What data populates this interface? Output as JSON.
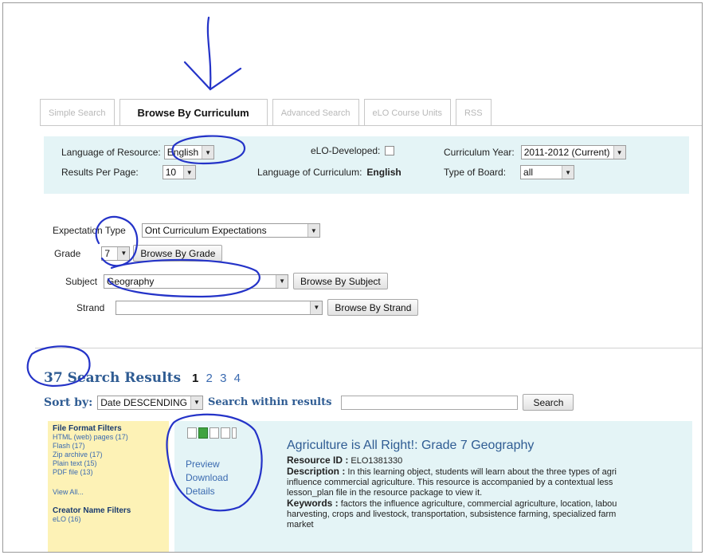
{
  "tabs": [
    {
      "label": "Simple Search",
      "active": false
    },
    {
      "label": "Browse By Curriculum",
      "active": true
    },
    {
      "label": "Advanced Search",
      "active": false
    },
    {
      "label": "eLO Course Units",
      "active": false
    },
    {
      "label": "RSS",
      "active": false
    }
  ],
  "options": {
    "language_resource_label": "Language of Resource:",
    "language_resource_value": "English",
    "elo_developed_label": "eLO-Developed:",
    "curriculum_year_label": "Curriculum Year:",
    "curriculum_year_value": "2011-2012 (Current)",
    "results_per_page_label": "Results Per Page:",
    "results_per_page_value": "10",
    "language_curriculum_label": "Language of Curriculum:",
    "language_curriculum_value": "English",
    "type_board_label": "Type of Board:",
    "type_board_value": "all"
  },
  "browse": {
    "expectation_type_label": "Expectation Type",
    "expectation_type_value": "Ont Curriculum Expectations",
    "grade_label": "Grade",
    "grade_value": "7",
    "browse_grade_button": "Browse By Grade",
    "subject_label": "Subject",
    "subject_value": "Geography",
    "browse_subject_button": "Browse By Subject",
    "strand_label": "Strand",
    "strand_value": "",
    "browse_strand_button": "Browse By Strand"
  },
  "results": {
    "count_text": "37 Search Results",
    "pages": [
      "1",
      "2",
      "3",
      "4"
    ],
    "current_page": "1",
    "sort_label": "Sort by:",
    "sort_value": "Date DESCENDING",
    "search_within_label": "Search within results",
    "search_button": "Search"
  },
  "filters": {
    "file_format_heading": "File Format Filters",
    "file_format_items": [
      "HTML (web) pages (17)",
      "Flash (17)",
      "Zip archive (17)",
      "Plain text (15)",
      "PDF file (13)"
    ],
    "view_all": "View All...",
    "creator_heading": "Creator Name Filters",
    "creator_items": [
      "eLO (16)"
    ]
  },
  "result_item": {
    "actions": [
      "Preview",
      "Download",
      "Details"
    ],
    "title": "Agriculture is All Right!: Grade 7 Geography",
    "resource_id_label": "Resource ID :",
    "resource_id": "ELO1381330",
    "description_label": "Description :",
    "description_lines": [
      "In this learning object, students will learn about the three types of agri",
      "influence commercial agriculture. This resource is accompanied by a contextual less",
      "lesson_plan file in the resource package to view it."
    ],
    "keywords_label": "Keywords :",
    "keywords_lines": [
      "factors the influence agriculture, commercial agriculture, location, labou",
      "harvesting, crops and livestock, transportation, subsistence farming, specialized farm",
      "market"
    ]
  }
}
